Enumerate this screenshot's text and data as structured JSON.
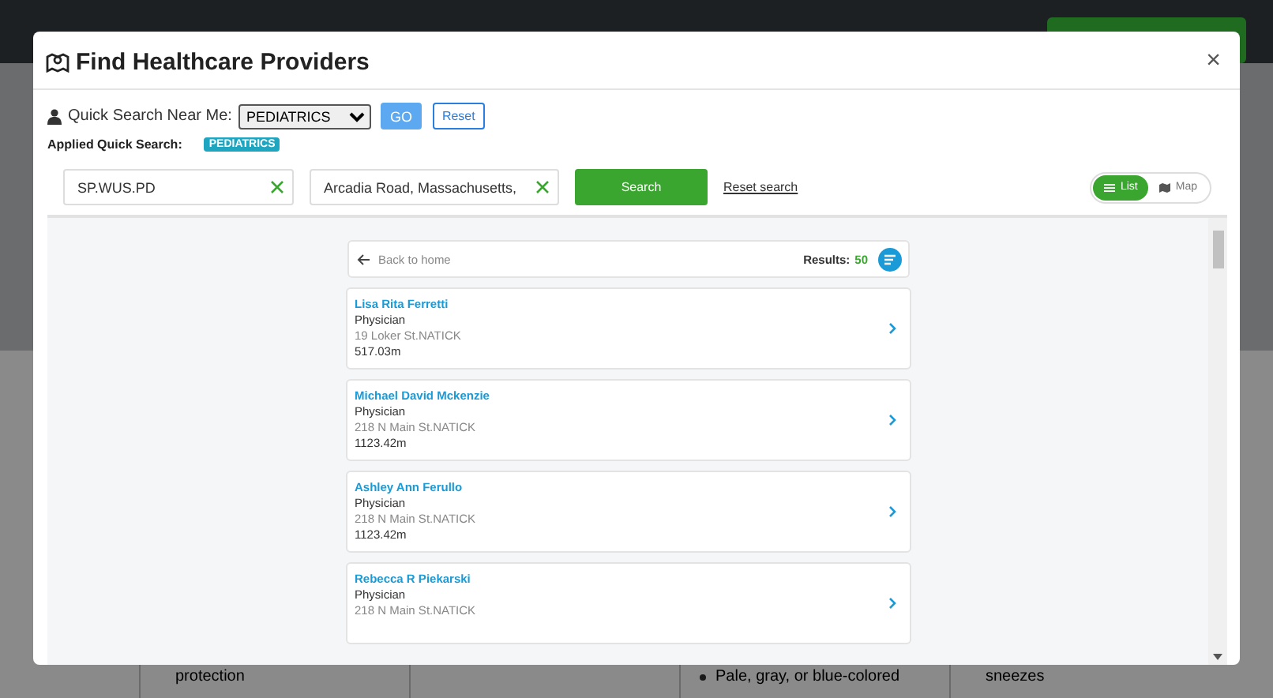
{
  "background": {
    "columns": [
      {
        "lines": [
          {
            "text": "protection",
            "bullet": false
          }
        ]
      },
      {},
      {
        "lines": [
          {
            "text": "Pale, gray, or blue-colored",
            "bullet": true
          }
        ]
      },
      {
        "lines": [
          {
            "text": "sneezes",
            "bullet": false
          }
        ]
      }
    ]
  },
  "modal": {
    "title": "Find Healthcare Providers",
    "close": "×"
  },
  "quick_search": {
    "label": "Quick Search Near Me:",
    "value": "PEDIATRICS",
    "go": "GO",
    "reset": "Reset"
  },
  "applied": {
    "label": "Applied Quick Search:",
    "badge": "PEDIATRICS"
  },
  "search": {
    "query": "SP.WUS.PD",
    "location": "Arcadia Road, Massachusetts,",
    "button": "Search",
    "reset_link": "Reset search"
  },
  "view_toggle": [
    {
      "label": "List",
      "kind": "list",
      "selected": true
    },
    {
      "label": "Map",
      "kind": "map",
      "selected": false
    }
  ],
  "results_header": {
    "back": "Back to home",
    "label": "Results:",
    "count": "50"
  },
  "providers": [
    {
      "name": "Lisa Rita Ferretti",
      "role": "Physician",
      "address": "19 Loker St.NATICK",
      "distance": "517.03m"
    },
    {
      "name": "Michael David Mckenzie",
      "role": "Physician",
      "address": "218 N Main St.NATICK",
      "distance": "1123.42m"
    },
    {
      "name": "Ashley Ann Ferullo",
      "role": "Physician",
      "address": "218 N Main St.NATICK",
      "distance": "1123.42m"
    },
    {
      "name": "Rebecca R Piekarski",
      "role": "Physician",
      "address": "218 N Main St.NATICK"
    }
  ]
}
